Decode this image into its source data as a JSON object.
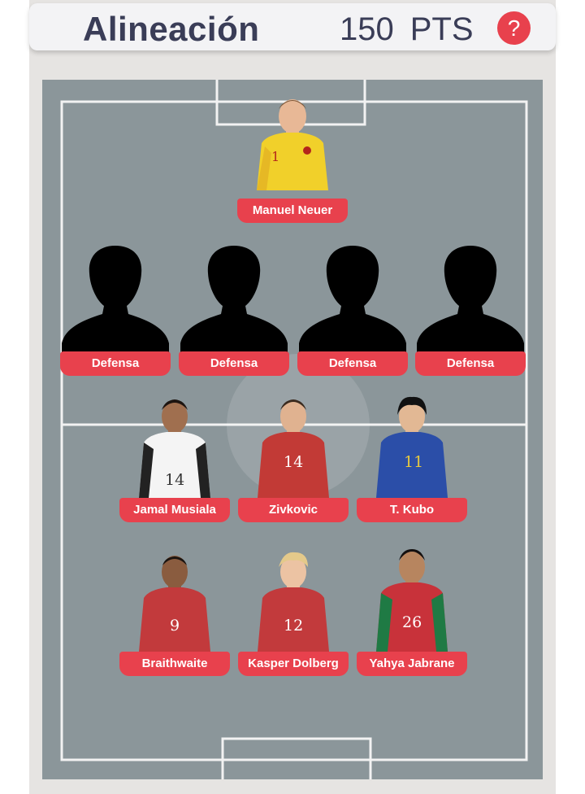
{
  "header": {
    "title": "Alineación",
    "points_value": "150",
    "points_label": "PTS",
    "help_label": "?"
  },
  "colors": {
    "accent": "#e8414d",
    "pitch": "#8b969a",
    "title_text": "#3a3d57"
  },
  "lineup": {
    "goalkeeper": [
      {
        "name": "Manuel Neuer",
        "number": "1",
        "kit": "yellow"
      }
    ],
    "defenders": [
      {
        "name": "Defensa",
        "number": "",
        "kit": "silhouette"
      },
      {
        "name": "Defensa",
        "number": "",
        "kit": "silhouette"
      },
      {
        "name": "Defensa",
        "number": "",
        "kit": "silhouette"
      },
      {
        "name": "Defensa",
        "number": "",
        "kit": "silhouette"
      }
    ],
    "midfielders": [
      {
        "name": "Jamal Musiala",
        "number": "14",
        "kit": "white"
      },
      {
        "name": "Zivkovic",
        "number": "14",
        "kit": "red"
      },
      {
        "name": "T. Kubo",
        "number": "11",
        "kit": "blue"
      }
    ],
    "forwards": [
      {
        "name": "Braithwaite",
        "number": "9",
        "kit": "red"
      },
      {
        "name": "Kasper Dolberg",
        "number": "12",
        "kit": "red"
      },
      {
        "name": "Yahya Jabrane",
        "number": "26",
        "kit": "red-green"
      }
    ]
  }
}
